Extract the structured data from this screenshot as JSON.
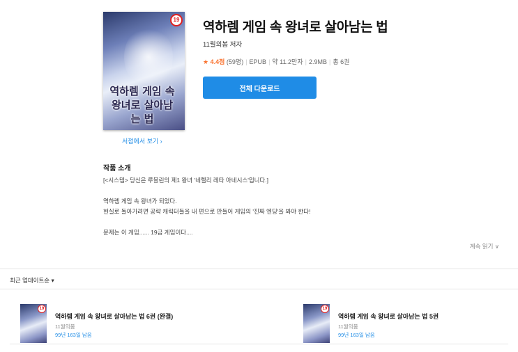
{
  "book": {
    "cover_badge": "19",
    "cover_title": "역하렘 게임 속 왕녀로 살아남는 법",
    "store_link": "서점에서 보기 ›",
    "title": "역하렘 게임 속 왕녀로 살아남는 법",
    "author": "11월의봄 저자",
    "star_icon": "★",
    "rating": "4.4점",
    "rating_count": "(59명)",
    "format": "EPUB",
    "char_count": "약 11.2만자",
    "file_size": "2.9MB",
    "volumes": "총 6권",
    "download_label": "전체 다운로드"
  },
  "intro": {
    "heading": "작품 소개",
    "line1": "[<시스템> 당신은 루블린의 제1 왕녀 '네렐리 레타 아네시스'입니다.]",
    "line2": "역하렘 게임 속 왕녀가 되었다.",
    "line3": "현실로 돌아가려면 공략 캐릭터들을 내 편으로 만들어 게임의 '진짜 엔딩'을 봐야 한다!",
    "line4": "문제는 이 게임...... 19금 게임이다....",
    "more_label": "계속 읽기 ∨"
  },
  "list": {
    "sort_label": "최근 업데이트순 ▾",
    "items": [
      {
        "badge": "19",
        "title": "역하렘 게임 속 왕녀로 살아남는 법 6권 (완결)",
        "author": "11월의봄",
        "rental": "99년 163일 남음"
      },
      {
        "badge": "19",
        "title": "역하렘 게임 속 왕녀로 살아남는 법 5권",
        "author": "11월의봄",
        "rental": "99년 163일 남음"
      }
    ]
  },
  "colors": {
    "accent": "#1f8ce6",
    "rating": "#fa722e",
    "badge": "#e02020"
  }
}
